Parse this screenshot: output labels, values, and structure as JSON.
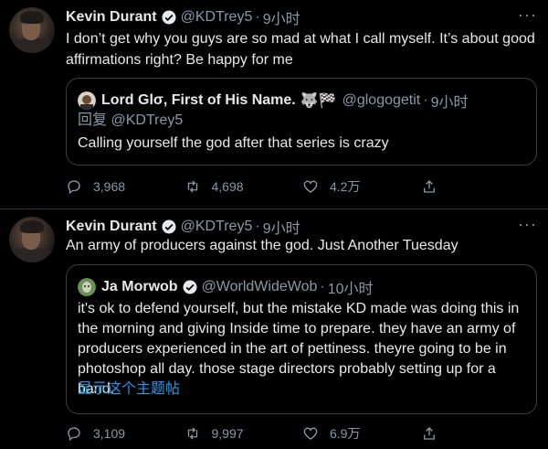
{
  "tweets": [
    {
      "name": "Kevin Durant",
      "handle": "@KDTrey5",
      "time": "9小时",
      "text": "I don’t get why you guys are so mad  at what I call myself. It’s about good affirmations right? Be happy for me",
      "quote": {
        "name": "Lord Glσ, First of His Name.",
        "emoji": "🐺🏁",
        "handle": "@glogogetit",
        "time": "9小时",
        "reply_prefix": "回复",
        "reply_to": "@KDTrey5",
        "text": "Calling yourself the god after that series is crazy"
      },
      "stats": {
        "replies": "3,968",
        "retweets": "4,698",
        "likes": "4.2万"
      }
    },
    {
      "name": "Kevin Durant",
      "handle": "@KDTrey5",
      "time": "9小时",
      "text": "An army of producers against the god. Just Another Tuesday",
      "quote": {
        "name": "Ja Morwob",
        "handle": "@WorldWideWob",
        "time": "10小时",
        "text": "it's ok to defend yourself, but the mistake KD made was doing this in the morning and giving Inside time to prepare. they have an army of producers experienced in the art of pettiness. theyre going to be in photoshop all day. those stage directors probably setting up for a band.",
        "show_thread": "显示这个主题帖"
      },
      "stats": {
        "replies": "3,109",
        "retweets": "9,997",
        "likes": "6.9万"
      }
    }
  ],
  "ui": {
    "dot": "·",
    "more": "···"
  },
  "colors": {
    "background": "#000000",
    "accent": "#1d9bf0",
    "muted": "#8b98a5",
    "border": "#2f3336"
  }
}
